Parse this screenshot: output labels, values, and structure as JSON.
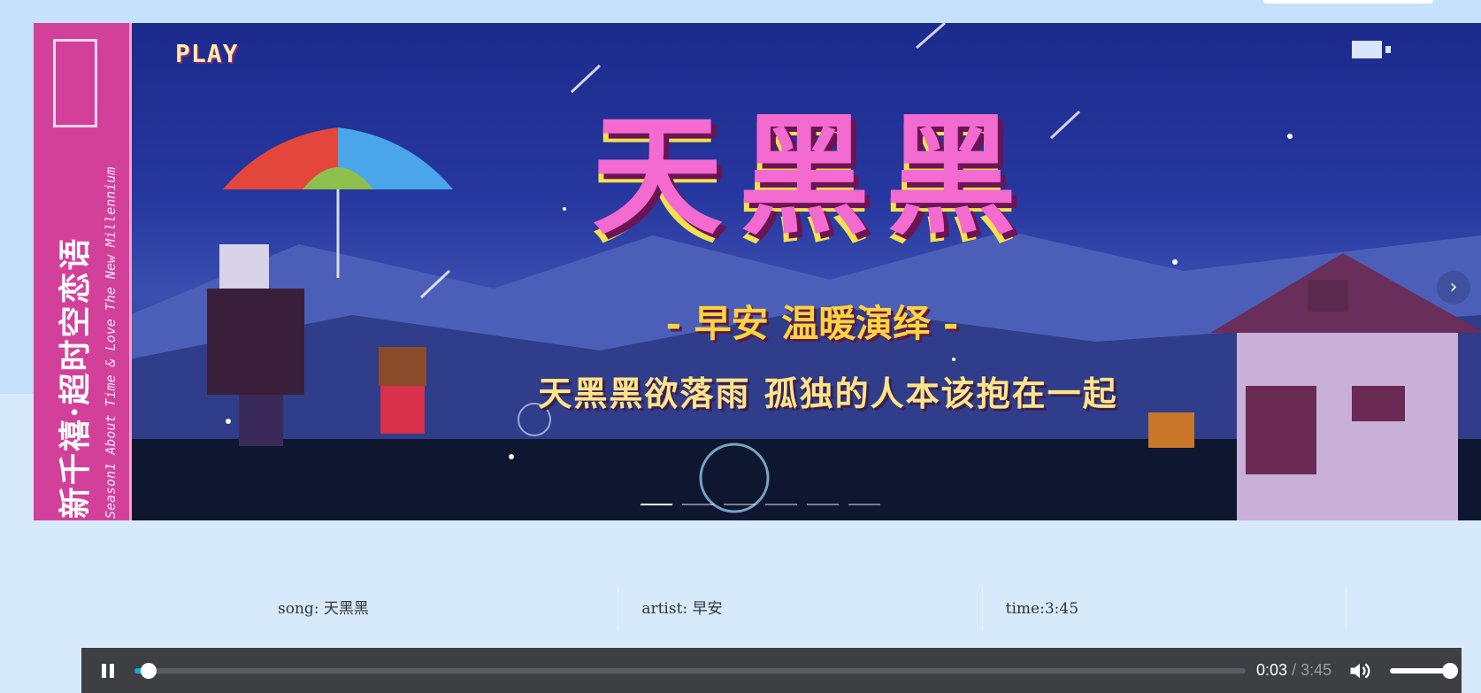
{
  "banner": {
    "play_tag": "PLAY",
    "title": "天黑黑",
    "subtitle": "- 早安 温暖演绎 -",
    "lyric": "天黑黑欲落雨 孤独的人本该抱在一起",
    "side_title": "新千禧·超时空恋语",
    "side_caption": "Season1 About Time & Love The New Millennium",
    "prev_icon": "chevron-left-icon",
    "next_icon": "chevron-right-icon",
    "prev_glyph": "‹",
    "next_glyph": "›",
    "slide_count": 6,
    "active_slide": 1
  },
  "song_info": {
    "song": "song: 天黑黑",
    "artist": "artist: 早安",
    "time": "time:3:45"
  },
  "player": {
    "state": "playing",
    "current_time": "0:03",
    "separator": "/",
    "duration": "3:45",
    "progress_fraction": 0.013,
    "volume_fraction": 1.0,
    "accent_color": "#1ba6e6"
  }
}
